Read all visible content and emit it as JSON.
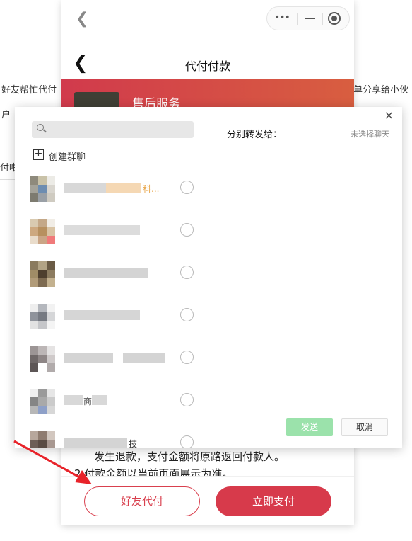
{
  "background_page": {
    "left_text_1": "好友帮忙代付",
    "left_text_2": "户",
    "left_text_3": "付咁",
    "right_text": "单分享给小伙"
  },
  "mini_program": {
    "capsule_more": "•••",
    "capsule_icons": [
      "more-icon",
      "minimize-icon",
      "close-target-icon"
    ],
    "nav_title": "代付付款",
    "banner_title": "售后服务",
    "notice_line_1": "发生退款，支付金额将原路返回付款人。",
    "notice_line_2": "2.付款金额以当前页面展示为准。",
    "friend_pay_label": "好友代付",
    "pay_now_label": "立即支付",
    "accent_color": "#d73a4b"
  },
  "share_dialog": {
    "search_placeholder": "",
    "create_group_label": "创建群聊",
    "send_to_label": "分别转发给：",
    "no_chat_selected": "未选择聊天",
    "send_label": "发送",
    "cancel_label": "取消",
    "close_label": "×",
    "contacts": [
      {
        "visible_text": "科..."
      },
      {
        "visible_text": ""
      },
      {
        "visible_text": ""
      },
      {
        "visible_text": ""
      },
      {
        "visible_text": ""
      },
      {
        "visible_text": "商"
      },
      {
        "visible_text": "技"
      }
    ],
    "send_color": "#9be2ab"
  }
}
